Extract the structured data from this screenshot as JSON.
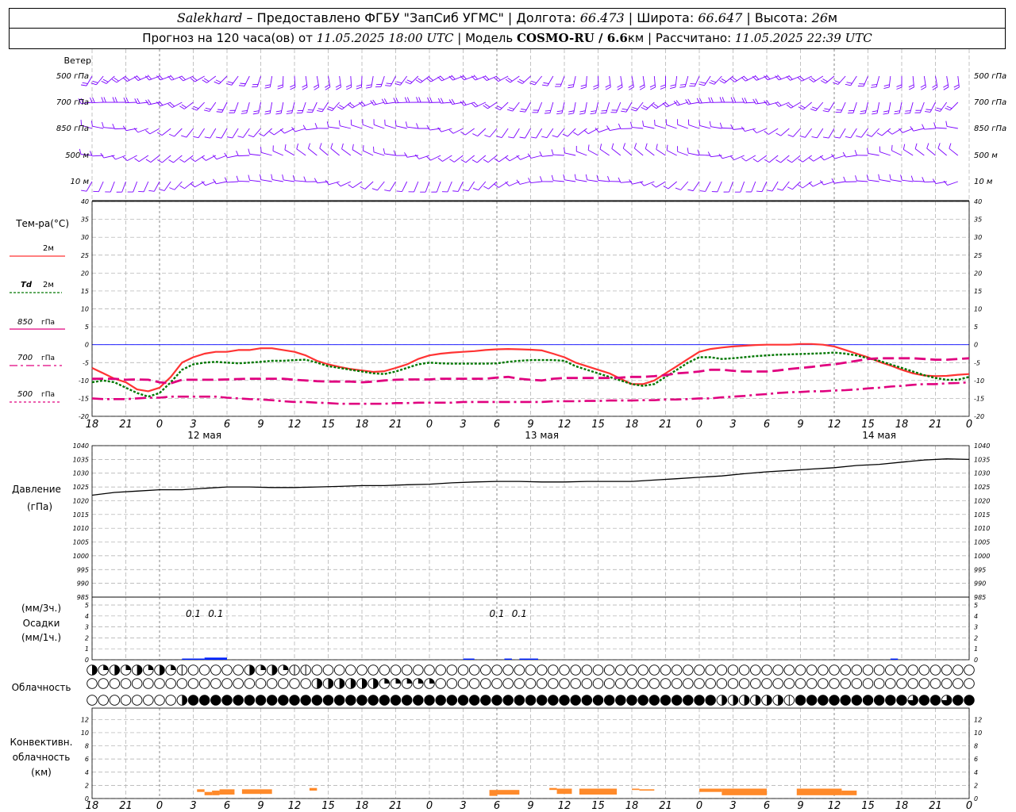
{
  "header": {
    "station": "Salekhard",
    "provider": " – Предоставлено ФГБУ \"ЗапСиб УГМС\" | Долгота: ",
    "lon": "66.473",
    "lat_label": " | Широта: ",
    "lat": "66.647",
    "alt_label": " | Высота: ",
    "alt": "26",
    "alt_unit": "м",
    "forecast_label": "Прогноз на 120 часа(ов) от ",
    "forecast_time": "11.05.2025 18:00 UTC",
    "model_label": " | Модель ",
    "model": "COSMO-RU / 6.6",
    "model_unit": "км",
    "calc_label": " | Рассчитано: ",
    "calc_time": "11.05.2025 22:39 UTC"
  },
  "labels": {
    "wind": "Ветер",
    "temp": "Тем-ра(°С)",
    "t2m": "2м",
    "td": "Td",
    "td_level": "2м",
    "l850": "850",
    "l700": "700",
    "l500": "500",
    "hpa": "гПа",
    "pressure": "Давление",
    "pressure_unit": "(гПа)",
    "precip_3h": "(мм/3ч.)",
    "precip": "Осадки",
    "precip_1h": "(мм/1ч.)",
    "cloud": "Облачность",
    "conv1": "Конвективн.",
    "conv2": "облачность",
    "conv3": "(км)"
  },
  "wind_levels": [
    "500 гПа",
    "700 гПа",
    "850 гПа",
    "500 м",
    "10 м"
  ],
  "time_ticks": [
    "18",
    "21",
    "0",
    "3",
    "6",
    "9",
    "12",
    "15",
    "18",
    "21",
    "0",
    "3",
    "6",
    "9",
    "12",
    "15",
    "18",
    "21",
    "0",
    "3",
    "6",
    "9",
    "12",
    "15",
    "18",
    "21",
    "0"
  ],
  "days": [
    "12 мая",
    "13 мая",
    "14 мая"
  ],
  "colors": {
    "t2m": "#ff3333",
    "td": "#007700",
    "pink": "#e0007f",
    "wind": "#7a00ff",
    "precip": "#0022ff",
    "conv": "#ff8a2a",
    "zero": "#0000ff"
  },
  "chart_data": [
    {
      "type": "line",
      "title": "Тем-ра(°С)",
      "x_hours": [
        0,
        3,
        6,
        9,
        12,
        15,
        18,
        21,
        24,
        27,
        30,
        33,
        36,
        39,
        42,
        45,
        48,
        51,
        54,
        57,
        60,
        63,
        66,
        69,
        72,
        75,
        78,
        81,
        84,
        87,
        90,
        93,
        96,
        99,
        102,
        105,
        108,
        111,
        114,
        117,
        120,
        123,
        126,
        129,
        132,
        135,
        138,
        141,
        144,
        147,
        150,
        153,
        156,
        159,
        162,
        165,
        168,
        171,
        174,
        177,
        180,
        183,
        186,
        189,
        192,
        195,
        198,
        201,
        204,
        207,
        210,
        213,
        216,
        219,
        222,
        225,
        228,
        231,
        234
      ],
      "ylim": [
        -20,
        40
      ],
      "series": [
        {
          "name": "2м",
          "values": [
            -6.5,
            -8,
            -9.5,
            -10.5,
            -12.5,
            -13,
            -12,
            -9,
            -5,
            -3.5,
            -2.5,
            -2,
            -2,
            -1.5,
            -1.5,
            -1,
            -1,
            -1.5,
            -2,
            -3,
            -4.5,
            -5.5,
            -6.2,
            -6.8,
            -7.2,
            -7.6,
            -7.4,
            -6.5,
            -5.5,
            -4,
            -3,
            -2.5,
            -2.2,
            -2,
            -1.8,
            -1.5,
            -1.3,
            -1.2,
            -1.3,
            -1.4,
            -1.6,
            -2.5,
            -3.5,
            -5,
            -6,
            -7,
            -8,
            -9.5,
            -11,
            -11,
            -10,
            -8,
            -6,
            -4,
            -2,
            -1.2,
            -0.8,
            -0.5,
            -0.3,
            -0.1,
            0,
            0,
            0,
            0.2,
            0.2,
            0,
            -0.5,
            -1.5,
            -2.5,
            -3.5,
            -4.8,
            -5.8,
            -7,
            -8,
            -8.6,
            -8.8,
            -8.7,
            -8.4,
            -8.2
          ]
        },
        {
          "name": "Td 2м",
          "values": [
            -10.5,
            -10,
            -10.5,
            -12,
            -13.5,
            -14.5,
            -13.5,
            -10.5,
            -7,
            -5.5,
            -5,
            -4.8,
            -5,
            -5.2,
            -5,
            -4.8,
            -4.5,
            -4.5,
            -4.3,
            -4.2,
            -5,
            -6,
            -6.5,
            -7,
            -7.5,
            -8,
            -8.2,
            -7.5,
            -6.5,
            -5.5,
            -5,
            -5.2,
            -5.3,
            -5.3,
            -5.3,
            -5.3,
            -5.2,
            -4.8,
            -4.5,
            -4.3,
            -4.3,
            -4.3,
            -4.5,
            -6,
            -7,
            -8,
            -9,
            -10,
            -11,
            -11.5,
            -11,
            -9,
            -7,
            -5,
            -3.5,
            -3.5,
            -4,
            -3.8,
            -3.5,
            -3.2,
            -3,
            -2.8,
            -2.7,
            -2.6,
            -2.5,
            -2.4,
            -2.2,
            -2.5,
            -3,
            -3.8,
            -4.5,
            -5.5,
            -6.5,
            -7.5,
            -8.5,
            -9.3,
            -9.8,
            -9.8,
            -9
          ]
        },
        {
          "name": "850 гПа",
          "values": [
            -9.5,
            -9.5,
            -9.5,
            -9.8,
            -9.7,
            -9.8,
            -10.5,
            -10.8,
            -9.8,
            -9.8,
            -9.8,
            -9.8,
            -9.7,
            -9.6,
            -9.5,
            -9.5,
            -9.5,
            -9.5,
            -9.8,
            -10,
            -10.2,
            -10.3,
            -10.3,
            -10.3,
            -10.5,
            -10.3,
            -10,
            -9.8,
            -9.7,
            -9.7,
            -9.7,
            -9.5,
            -9.5,
            -9.5,
            -9.5,
            -9.5,
            -9.2,
            -9,
            -9.5,
            -9.8,
            -10,
            -9.5,
            -9.3,
            -9.3,
            -9.3,
            -9.3,
            -9.3,
            -9.2,
            -9,
            -9,
            -8.8,
            -8.5,
            -8,
            -7.8,
            -7.5,
            -7,
            -7,
            -7.3,
            -7.5,
            -7.5,
            -7.5,
            -7.2,
            -6.8,
            -6.5,
            -6.2,
            -5.8,
            -5.5,
            -5,
            -4.5,
            -4,
            -3.8,
            -3.8,
            -3.8,
            -3.8,
            -4,
            -4.2,
            -4.2,
            -4,
            -3.8
          ]
        },
        {
          "name": "700 гПа",
          "values": [
            -15,
            -15.2,
            -15.2,
            -15.2,
            -15,
            -14.8,
            -14.8,
            -14.5,
            -14.5,
            -14.5,
            -14.5,
            -14.5,
            -14.8,
            -15,
            -15.2,
            -15.3,
            -15.5,
            -15.8,
            -16,
            -16,
            -16.2,
            -16.3,
            -16.5,
            -16.5,
            -16.5,
            -16.5,
            -16.5,
            -16.3,
            -16.3,
            -16.2,
            -16.2,
            -16.2,
            -16.2,
            -16,
            -16,
            -16,
            -16,
            -16,
            -16,
            -16,
            -16,
            -15.8,
            -15.8,
            -15.8,
            -15.7,
            -15.7,
            -15.6,
            -15.6,
            -15.6,
            -15.5,
            -15.5,
            -15.3,
            -15.3,
            -15.2,
            -15,
            -15,
            -14.7,
            -14.5,
            -14.3,
            -14,
            -13.8,
            -13.5,
            -13.3,
            -13.2,
            -13,
            -13,
            -12.8,
            -12.7,
            -12.5,
            -12.2,
            -12,
            -11.7,
            -11.5,
            -11.2,
            -11,
            -11,
            -10.8,
            -10.7,
            -10.5
          ]
        }
      ]
    },
    {
      "type": "line",
      "title": "Давление",
      "ylabel": "(гПа)",
      "ylim": [
        985,
        1040
      ],
      "x_hours": [
        0,
        6,
        12,
        18,
        24,
        30,
        36,
        42,
        48,
        54,
        60,
        66,
        72,
        78,
        84,
        90,
        96,
        102,
        108,
        114,
        120,
        126,
        132,
        138,
        144,
        150,
        156,
        162,
        168,
        174,
        180,
        186,
        192,
        198,
        204,
        210,
        216,
        222,
        228,
        234
      ],
      "series": [
        {
          "name": "Давление",
          "values": [
            1022,
            1023,
            1023.5,
            1024,
            1024,
            1024.5,
            1025,
            1025,
            1024.8,
            1024.8,
            1025,
            1025.2,
            1025.5,
            1025.5,
            1025.8,
            1026,
            1026.5,
            1026.8,
            1027,
            1027,
            1026.8,
            1026.8,
            1027,
            1027,
            1027,
            1027.5,
            1028,
            1028.5,
            1029,
            1029.8,
            1030.5,
            1031,
            1031.5,
            1032,
            1032.8,
            1033.2,
            1034,
            1034.8,
            1035.2,
            1035
          ]
        }
      ]
    },
    {
      "type": "bar",
      "title": "Осадки",
      "ylabel": "(мм/3ч.)",
      "ylim": [
        0,
        5
      ],
      "annotations": [
        {
          "x_hour": 27,
          "text": "0.1"
        },
        {
          "x_hour": 33,
          "text": "0.1"
        },
        {
          "x_hour": 108,
          "text": "0.1"
        },
        {
          "x_hour": 114,
          "text": "0.1"
        }
      ],
      "bars": [
        {
          "start": 30,
          "end": 36,
          "value": 0.15
        },
        {
          "start": 24,
          "end": 30,
          "value": 0.05
        },
        {
          "start": 99,
          "end": 102,
          "value": 0.04
        },
        {
          "start": 110,
          "end": 112,
          "value": 0.05
        },
        {
          "start": 114,
          "end": 119,
          "value": 0.06
        },
        {
          "start": 213,
          "end": 215,
          "value": 0.04
        }
      ]
    },
    {
      "type": "bar",
      "title": "Конвективн. облачность",
      "ylabel": "(км)",
      "ylim": [
        0,
        12
      ],
      "bars": [
        {
          "start": 28,
          "end": 30,
          "bottom": 1.0,
          "top": 1.4
        },
        {
          "start": 30,
          "end": 32,
          "bottom": 0.5,
          "top": 1.0
        },
        {
          "start": 32,
          "end": 34,
          "bottom": 0.5,
          "top": 1.2
        },
        {
          "start": 34,
          "end": 38,
          "bottom": 0.6,
          "top": 1.4
        },
        {
          "start": 40,
          "end": 48,
          "bottom": 0.7,
          "top": 1.4
        },
        {
          "start": 58,
          "end": 60,
          "bottom": 1.2,
          "top": 1.6
        },
        {
          "start": 106,
          "end": 108,
          "bottom": 0.4,
          "top": 1.3
        },
        {
          "start": 108,
          "end": 114,
          "bottom": 0.6,
          "top": 1.3
        },
        {
          "start": 122,
          "end": 124,
          "bottom": 1.3,
          "top": 1.6
        },
        {
          "start": 124,
          "end": 128,
          "bottom": 0.7,
          "top": 1.5
        },
        {
          "start": 130,
          "end": 140,
          "bottom": 0.6,
          "top": 1.5
        },
        {
          "start": 144,
          "end": 146,
          "bottom": 1.3,
          "top": 1.5
        },
        {
          "start": 146,
          "end": 150,
          "bottom": 1.2,
          "top": 1.4
        },
        {
          "start": 162,
          "end": 168,
          "bottom": 1.0,
          "top": 1.5
        },
        {
          "start": 168,
          "end": 180,
          "bottom": 0.5,
          "top": 1.5
        },
        {
          "start": 188,
          "end": 200,
          "bottom": 0.5,
          "top": 1.5
        },
        {
          "start": 200,
          "end": 204,
          "bottom": 0.5,
          "top": 1.2
        }
      ]
    },
    {
      "type": "table",
      "title": "Облачность",
      "rows": 3,
      "step_hours": 1.5,
      "codes": [
        "h q h q h q h q c e e e e e h q h q c c e e e e e e e e e e e e e e e e e e e e e e e e e e e e e e e e e e e e e e e e e e e e e e e e e e e e e e e e e e e e e e e e e e e e",
        "e e e e e e e e e e e e e e e e e e e e h h h h h h q q q q q e e e e e e e e e e e e e e e e e e e e e e e e e e e e e e e e e e e e e e e e e e e e e e e e e e e e e e e e",
        "e e e e e e e e h f f f f f f f f f f f f f f f f f f f f f f f f f f f f f f f f f f f f f f f f f f f f f f f h h h h h h c f f f f f f f f f f t f f t f f f f f f f t e e e e e e e h h"
      ]
    }
  ]
}
